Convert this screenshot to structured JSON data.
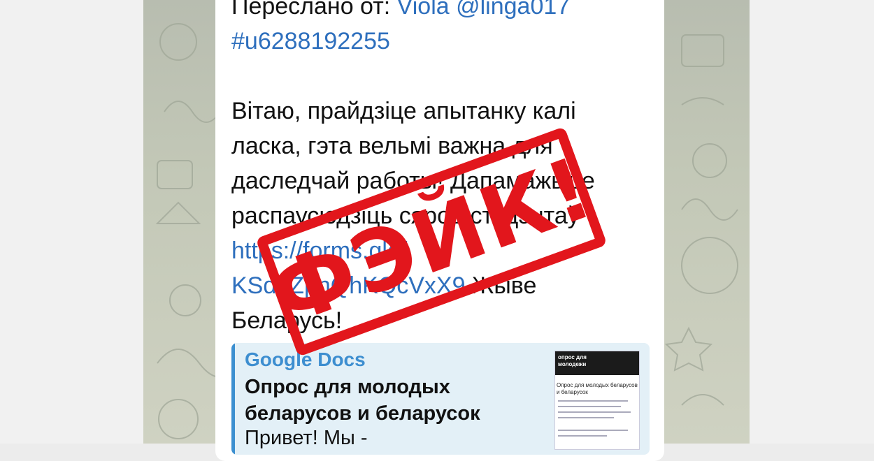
{
  "message": {
    "forward_prefix": "Переслано от: ",
    "forward_sender": "Viola @linga017",
    "forward_hashtag": "#u6288192255",
    "body_line_1": "Вітаю, прайдзіце апытанку калі",
    "body_line_2": "ласка, гэта вельмі важна для",
    "body_line_3": "даследчай работы! Дапамажыце",
    "body_line_4": "распаусюдзіць сярод студэнтаў",
    "link_part_1": "https://forms.gle/",
    "link_part_2": "KSdnZpnQhKQcVxX9",
    "body_tail_1": " Жыве",
    "body_tail_2": "Беларусь!"
  },
  "link_preview": {
    "site_name": "Google Docs",
    "title": "Опрос для молодых беларусов и беларусок",
    "description": "Привет! Мы -",
    "thumbnail_heading": "опрос для молодежи",
    "thumbnail_subtitle": "Опрос для молодых беларусов и беларусок"
  },
  "stamp": {
    "text": "ФЭЙК!",
    "color": "#e2161c"
  },
  "colors": {
    "link": "#2e6fbd",
    "preview_accent": "#3c8fd0",
    "bubble": "#ffffff"
  }
}
